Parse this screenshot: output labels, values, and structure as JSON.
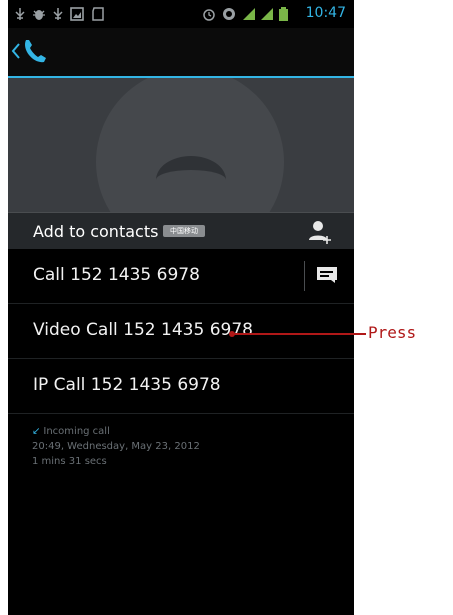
{
  "status_bar": {
    "time": "10:47",
    "icons": [
      "usb-icon",
      "bug-icon",
      "usb-icon",
      "image-icon",
      "sd-card-icon",
      "alarm-icon",
      "sync-icon",
      "signal-icon",
      "signal-icon",
      "battery-icon"
    ]
  },
  "action_bar": {
    "icon": "phone-handset-icon",
    "accent_color": "#33b5e5"
  },
  "contact": {
    "add_label": "Add to contacts",
    "carrier_badge": "中国移动",
    "add_icon": "add-contact-icon"
  },
  "actions": [
    {
      "label": "Call 152 1435 6978",
      "icon": "message-icon"
    },
    {
      "label": "Video Call 152 1435 6978"
    },
    {
      "label": "IP Call 152 1435 6978"
    }
  ],
  "call_log": {
    "type": "Incoming call",
    "datetime": "20:49, Wednesday, May 23, 2012",
    "duration": "1 mins 31 secs"
  },
  "annotation": {
    "label": "Press",
    "color": "#b01818"
  }
}
